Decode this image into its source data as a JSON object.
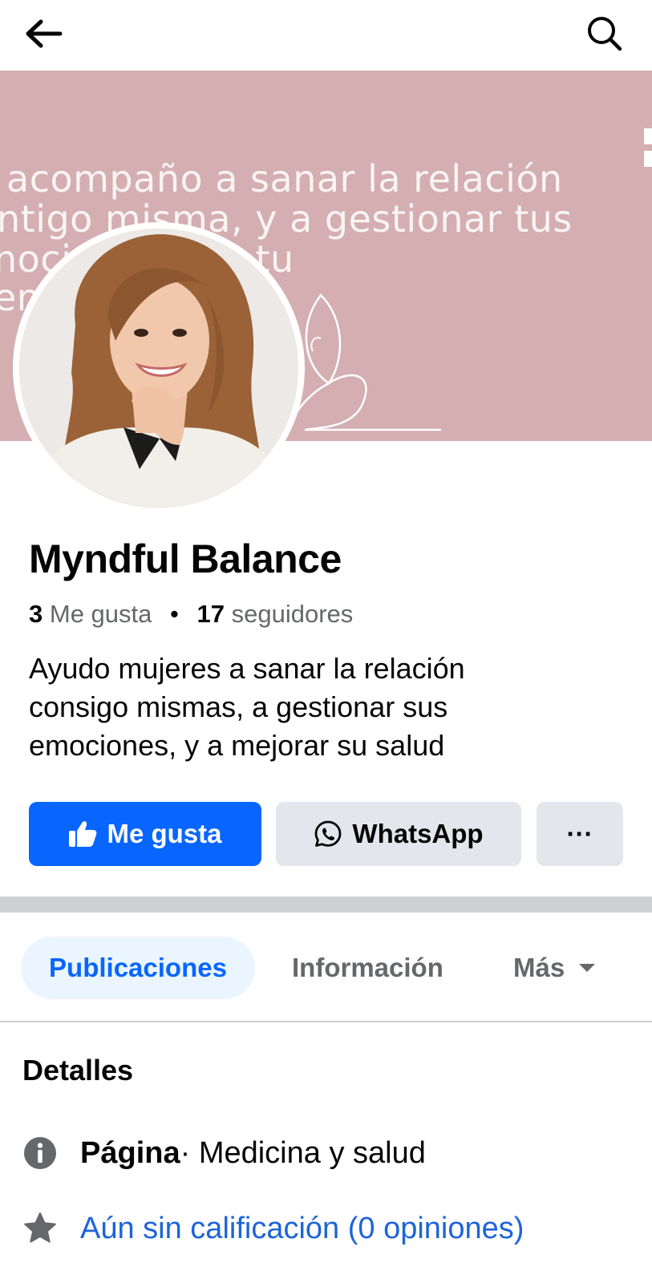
{
  "topbar": {
    "back_icon": "arrow-left-icon",
    "search_icon": "search-icon"
  },
  "cover": {
    "lines": [
      "acompaño a sanar la relación",
      "ntigo misma, y a gestionar tus",
      "noci          alcanzar tu",
      "en               al."
    ],
    "background": "#d4aeb0"
  },
  "page": {
    "name": "Myndful Balance",
    "likes_count": "3",
    "likes_label": "Me gusta",
    "followers_count": "17",
    "followers_label": "seguidores",
    "bio_lines": [
      "Ayudo mujeres a sanar la relación",
      "consigo mismas, a gestionar sus",
      "emociones, y a mejorar su salud"
    ]
  },
  "actions": {
    "like_label": "Me gusta",
    "whatsapp_label": "WhatsApp",
    "more_label": "···",
    "accent": "#0866ff"
  },
  "tabs": [
    {
      "label": "Publicaciones",
      "active": true
    },
    {
      "label": "Información",
      "active": false
    },
    {
      "label": "Más",
      "active": false
    }
  ],
  "details": {
    "title": "Detalles",
    "type_bold": "Página",
    "type_rest": " · Medicina y salud",
    "rating_text": "Aún sin calificación (0 opiniones)"
  }
}
